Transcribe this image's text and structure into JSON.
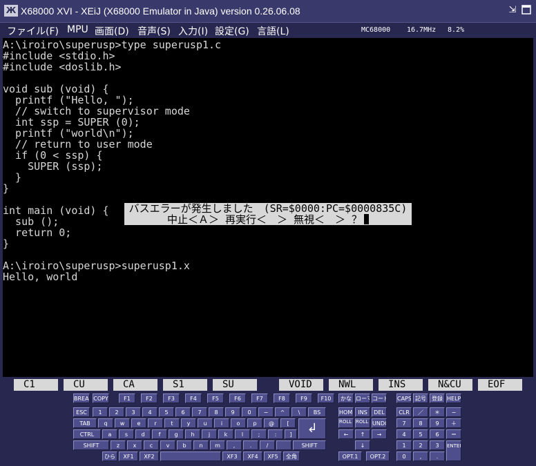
{
  "window": {
    "title": "X68000 XVI - XEiJ (X68000 Emulator in Java) version 0.26.06.08",
    "icon": "XEiJ",
    "buttons": [
      "restore-icon",
      "maximize-icon"
    ]
  },
  "menubar": {
    "items": [
      "ファイル(F)",
      "MPU",
      "画面(D)",
      "音声(S)",
      "入力(I)",
      "設定(G)",
      "言語(L)"
    ],
    "cpu": "MC68000",
    "clock": "16.7MHz",
    "load": "8.2%"
  },
  "terminal": {
    "lines": [
      "A:\\iroiro\\superusp>type superusp1.c",
      "#include <stdio.h>",
      "#include <doslib.h>",
      "",
      "void sub (void) {",
      "  printf (\"Hello, \");",
      "  // switch to supervisor mode",
      "  int ssp = SUPER (0);",
      "  printf (\"world\\n\");",
      "  // return to user mode",
      "  if (0 < ssp) {",
      "    SUPER (ssp);",
      "  }",
      "}",
      "",
      "int main (void) {",
      "  sub ();",
      "  return 0;",
      "}",
      "",
      "A:\\iroiro\\superusp>superusp1.x",
      "Hello, world"
    ]
  },
  "dialog": {
    "line1": "バスエラーが発生しました　(SR=$0000:PC=$0000835C)",
    "line2": "中止＜Ａ＞ 再実行＜　＞ 無視＜　＞ ？"
  },
  "function_keys": [
    "C1",
    "CU",
    "CA",
    "S1",
    "SU",
    "VOID",
    "NWL",
    "INS",
    "N&CU",
    "EOF"
  ],
  "keyboard": {
    "row0": [
      "BREAK",
      "COPY",
      "F1",
      "F2",
      "F3",
      "F4",
      "F5",
      "F6",
      "F7",
      "F8",
      "F9",
      "F10",
      "かな",
      "ローマ",
      "コード",
      "CAPS",
      "記号",
      "登録",
      "HELP"
    ],
    "row1": [
      "ESC",
      "1",
      "2",
      "3",
      "4",
      "5",
      "6",
      "7",
      "8",
      "9",
      "0",
      "−",
      "^",
      "\\",
      "BS",
      "HOME",
      "INS",
      "DEL",
      "CLR",
      "／",
      "＊",
      "−"
    ],
    "row2": [
      "TAB",
      "q",
      "w",
      "e",
      "r",
      "t",
      "y",
      "u",
      "i",
      "o",
      "p",
      "@",
      "[",
      "ROLL UP",
      "ROLL DOWN",
      "UNDO",
      "7",
      "8",
      "9",
      "＋"
    ],
    "row3": [
      "CTRL",
      "a",
      "s",
      "d",
      "f",
      "g",
      "h",
      "j",
      "k",
      "l",
      ";",
      ":",
      "]",
      "←",
      "↑",
      "→",
      "4",
      "5",
      "6",
      "＝"
    ],
    "row4": [
      "SHIFT",
      "z",
      "x",
      "c",
      "v",
      "b",
      "n",
      "m",
      ",",
      ".",
      "/",
      "",
      "SHIFT",
      "↓",
      "1",
      "2",
      "3",
      "ENTER"
    ],
    "row5": [
      "ひら",
      "XF1",
      "XF2",
      "",
      "XF3",
      "XF4",
      "XF5",
      "全角",
      "OPT.1",
      "OPT.2",
      "0",
      ",",
      "."
    ],
    "return_key": "↲"
  },
  "colors": {
    "frame": "#272750",
    "titlebar": "#39396c",
    "key_face": "#4e4e8c",
    "screen_text": "#d8d8d8",
    "label_background": "#d8d8d8"
  }
}
